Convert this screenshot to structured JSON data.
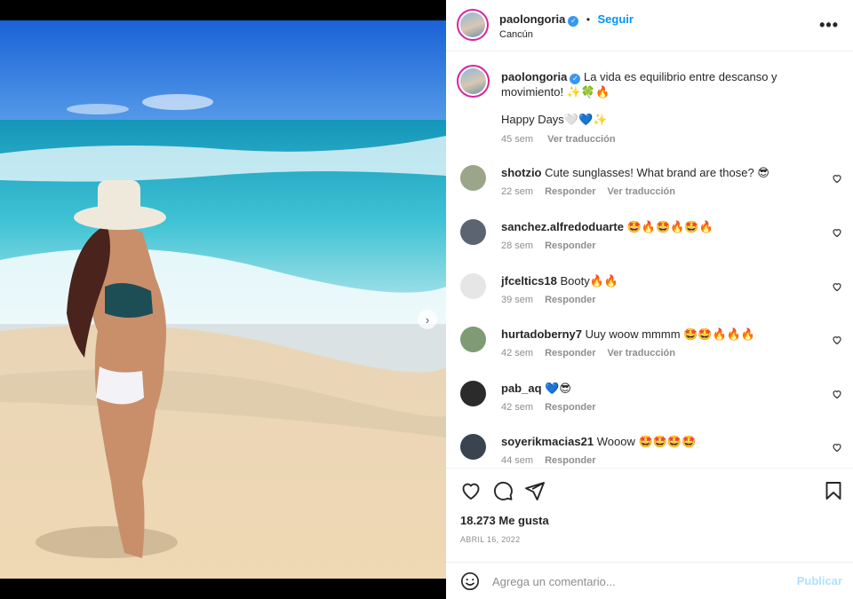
{
  "post": {
    "username": "paolongoria",
    "follow_label": "Seguir",
    "separator": "•",
    "location": "Cancún",
    "more_label": "•••",
    "next_label": "›"
  },
  "caption": {
    "username": "paolongoria",
    "text": "La vida es equilibrio entre descanso y movimiento! ✨🍀🔥",
    "second_line": "Happy Days🤍💙✨",
    "age": "45 sem",
    "translate": "Ver traducción"
  },
  "comments": [
    {
      "username": "shotzio",
      "text": "Cute sunglasses! What brand are those? 😎",
      "age": "22 sem",
      "reply": "Responder",
      "translate": "Ver traducción",
      "avatar_color": "#9aa58a"
    },
    {
      "username": "sanchez.alfredoduarte",
      "text": "🤩🔥🤩🔥🤩🔥",
      "age": "28 sem",
      "reply": "Responder",
      "translate": "",
      "avatar_color": "#5b6470"
    },
    {
      "username": "jfceltics18",
      "text": "Booty🔥🔥",
      "age": "39 sem",
      "reply": "Responder",
      "translate": "",
      "avatar_color": "#e6e6e6"
    },
    {
      "username": "hurtadoberny7",
      "text": "Uuy woow mmmm 🤩🤩🔥🔥🔥",
      "age": "42 sem",
      "reply": "Responder",
      "translate": "Ver traducción",
      "avatar_color": "#7f9b76"
    },
    {
      "username": "pab_aq",
      "text": "💙😎",
      "age": "42 sem",
      "reply": "Responder",
      "translate": "",
      "avatar_color": "#2b2b2b"
    },
    {
      "username": "soyerikmacias21",
      "text": "Wooow 🤩🤩🤩🤩",
      "age": "44 sem",
      "reply": "Responder",
      "translate": "",
      "avatar_color": "#3a4450"
    }
  ],
  "stats": {
    "likes": "18.273 Me gusta",
    "date": "ABRIL 16, 2022"
  },
  "composer": {
    "placeholder": "Agrega un comentario...",
    "publish_label": "Publicar"
  },
  "colors": {
    "accent": "#0095f6",
    "verified": "#3897f0",
    "muted": "#8e8e8e"
  }
}
